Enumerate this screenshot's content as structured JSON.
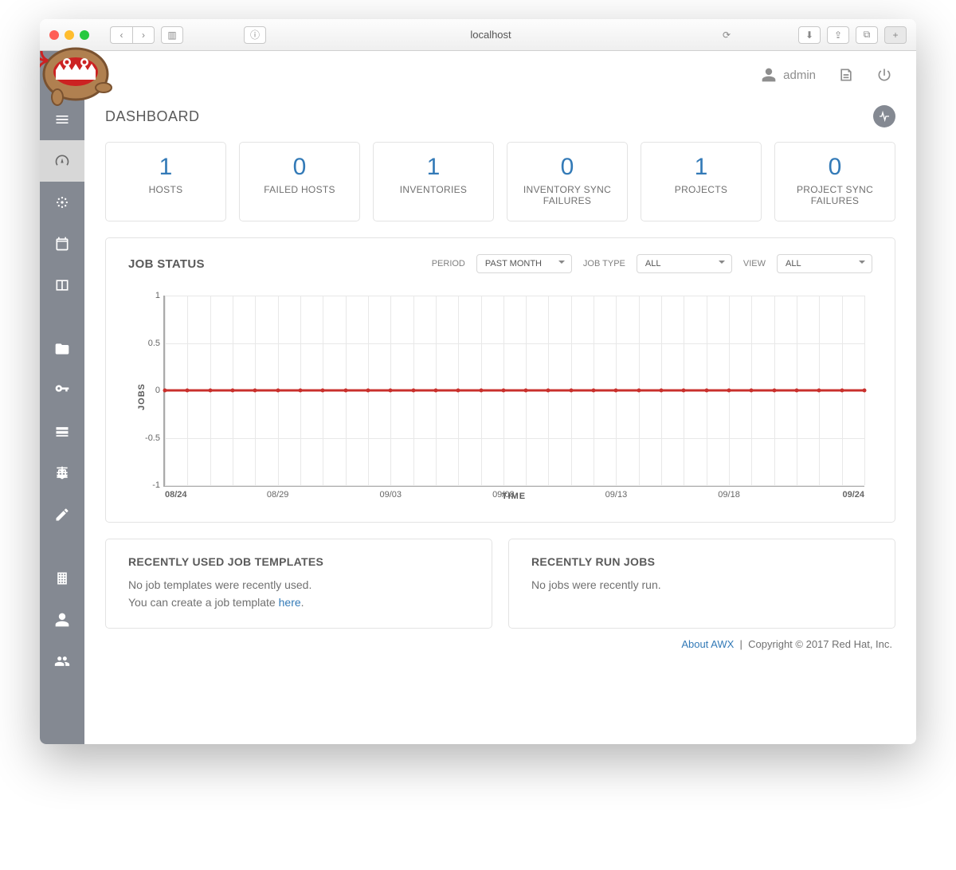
{
  "browser": {
    "address": "localhost"
  },
  "header": {
    "username": "admin"
  },
  "page_title": "DASHBOARD",
  "stats": [
    {
      "value": "1",
      "label": "HOSTS"
    },
    {
      "value": "0",
      "label": "FAILED HOSTS"
    },
    {
      "value": "1",
      "label": "INVENTORIES"
    },
    {
      "value": "0",
      "label": "INVENTORY SYNC FAILURES"
    },
    {
      "value": "1",
      "label": "PROJECTS"
    },
    {
      "value": "0",
      "label": "PROJECT SYNC FAILURES"
    }
  ],
  "job_status": {
    "title": "JOB STATUS",
    "filters": {
      "period_label": "PERIOD",
      "period_value": "PAST MONTH",
      "jobtype_label": "JOB TYPE",
      "jobtype_value": "ALL",
      "view_label": "VIEW",
      "view_value": "ALL"
    }
  },
  "chart_data": {
    "type": "line",
    "title": "JOB STATUS",
    "xlabel": "TIME",
    "ylabel": "JOBS",
    "ylim": [
      -1,
      1
    ],
    "yticks": [
      1,
      0.5,
      0,
      -0.5,
      -1
    ],
    "xticks": [
      "08/24",
      "08/29",
      "09/03",
      "09/08",
      "09/13",
      "09/18",
      "09/24"
    ],
    "categories": [
      "08/24",
      "08/25",
      "08/26",
      "08/27",
      "08/28",
      "08/29",
      "08/30",
      "08/31",
      "09/01",
      "09/02",
      "09/03",
      "09/04",
      "09/05",
      "09/06",
      "09/07",
      "09/08",
      "09/09",
      "09/10",
      "09/11",
      "09/12",
      "09/13",
      "09/14",
      "09/15",
      "09/16",
      "09/17",
      "09/18",
      "09/19",
      "09/20",
      "09/21",
      "09/22",
      "09/23",
      "09/24"
    ],
    "series": [
      {
        "name": "jobs",
        "color": "#c9302c",
        "values": [
          0,
          0,
          0,
          0,
          0,
          0,
          0,
          0,
          0,
          0,
          0,
          0,
          0,
          0,
          0,
          0,
          0,
          0,
          0,
          0,
          0,
          0,
          0,
          0,
          0,
          0,
          0,
          0,
          0,
          0,
          0,
          0
        ]
      }
    ]
  },
  "recent_templates": {
    "title": "RECENTLY USED JOB TEMPLATES",
    "line1": "No job templates were recently used.",
    "line2_pre": "You can create a job template ",
    "link": "here",
    "line2_post": "."
  },
  "recent_jobs": {
    "title": "RECENTLY RUN JOBS",
    "body": "No jobs were recently run."
  },
  "footer": {
    "about": "About AWX",
    "copyright": "Copyright © 2017 Red Hat, Inc."
  }
}
